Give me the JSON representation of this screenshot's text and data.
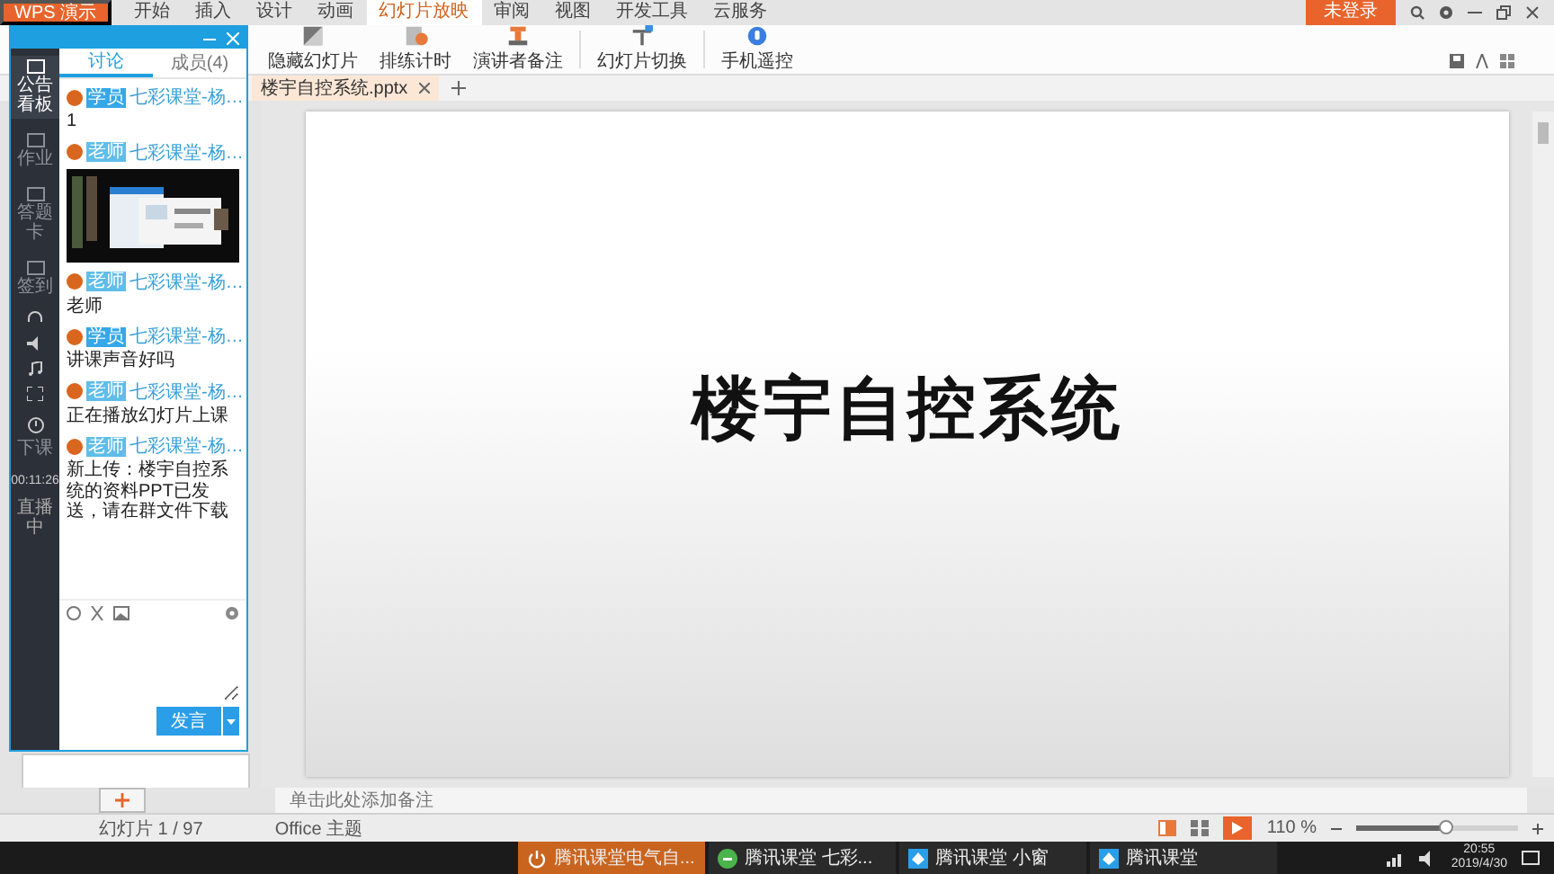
{
  "app": {
    "title": "WPS 演示"
  },
  "menu_tabs": [
    {
      "label": "开始",
      "selected": false
    },
    {
      "label": "插入",
      "selected": false
    },
    {
      "label": "设计",
      "selected": false
    },
    {
      "label": "动画",
      "selected": false
    },
    {
      "label": "幻灯片放映",
      "selected": true
    },
    {
      "label": "审阅",
      "selected": false
    },
    {
      "label": "视图",
      "selected": false
    },
    {
      "label": "开发工具",
      "selected": false
    },
    {
      "label": "云服务",
      "selected": false
    }
  ],
  "login_button": "未登录",
  "ribbon": [
    {
      "label": "隐藏幻灯片",
      "kind": "hide"
    },
    {
      "label": "排练计时",
      "kind": "timing"
    },
    {
      "label": "演讲者备注",
      "kind": "notes"
    },
    {
      "label": "幻灯片切换",
      "kind": "switch"
    },
    {
      "label": "手机遥控",
      "kind": "remote"
    }
  ],
  "document_tab": {
    "label": "楼宇自控系统.pptx"
  },
  "slide": {
    "title": "楼宇自控系统"
  },
  "notes": {
    "placeholder": "单击此处添加备注"
  },
  "status_bar": {
    "slide_counter": "幻灯片 1 / 97",
    "theme": "Office 主题",
    "zoom": "110 %",
    "zoom_slider": {
      "level": 0.55
    }
  },
  "chat": {
    "tabs": [
      {
        "label": "讨论",
        "selected": true
      },
      {
        "label": "成员(4)",
        "selected": false
      }
    ],
    "messages": [
      {
        "role": "学员",
        "kind": "text",
        "name": "七彩课堂-杨…",
        "text": "1"
      },
      {
        "role": "老师",
        "kind": "picture",
        "name": "七彩课堂-杨…"
      },
      {
        "role": "老师",
        "kind": "text",
        "name": "七彩课堂-杨…",
        "text": "老师"
      },
      {
        "role": "学员",
        "kind": "text",
        "name": "七彩课堂-杨…",
        "text": "讲课声音好吗"
      },
      {
        "role": "老师",
        "kind": "text",
        "name": "七彩课堂-杨…",
        "text": "正在播放幻灯片上课"
      },
      {
        "role": "老师",
        "kind": "text",
        "name": "七彩课堂-杨…",
        "text": "新上传：楼宇自控系统的资料PPT已发送，请在群文件下载"
      }
    ],
    "send_button": "发言"
  },
  "rail": {
    "items": [
      {
        "label": "公告看板",
        "selected": true
      },
      {
        "label": "作业",
        "selected": false
      },
      {
        "label": "答题卡",
        "selected": false
      },
      {
        "label": "签到",
        "selected": false
      }
    ],
    "end_button": "下课",
    "timer": "00:11:26",
    "status": "直播中"
  },
  "taskbar": {
    "windows": [
      {
        "label": "腾讯课堂电气自...",
        "kind": "power",
        "active": true
      },
      {
        "label": "腾讯课堂 七彩...",
        "kind": "green",
        "active": false
      },
      {
        "label": "腾讯课堂 小窗",
        "kind": "blue",
        "active": false
      },
      {
        "label": "腾讯课堂",
        "kind": "blue",
        "active": false
      }
    ],
    "time": "20:55",
    "date": "2019/4/30"
  }
}
